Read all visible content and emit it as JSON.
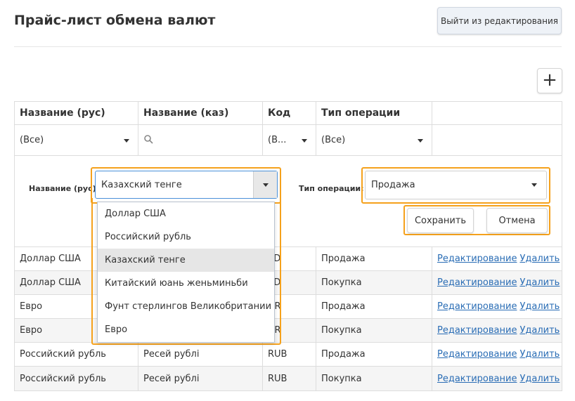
{
  "header": {
    "title": "Прайс-лист обмена валют",
    "exit_label": "Выйти из редактирования",
    "add_label": "+"
  },
  "grid": {
    "columns": [
      "Название (рус)",
      "Название (каз)",
      "Код",
      "Тип операции",
      ""
    ],
    "filters": {
      "name_ru": "(Все)",
      "name_kz": "",
      "code": "(В...",
      "operation": "(Все)"
    },
    "form": {
      "name_label": "Название (рус):",
      "name_value": "Казахский тенге",
      "op_label": "Тип операции:",
      "op_value": "Продажа",
      "save_label": "Сохранить",
      "cancel_label": "Отмена"
    },
    "rows": [
      {
        "name_ru": "Доллар США",
        "name_kz": "",
        "code": "SD",
        "op": "Продажа",
        "edit": "Редактирование",
        "del": "Удалить"
      },
      {
        "name_ru": "Доллар США",
        "name_kz": "",
        "code": "SD",
        "op": "Покупка",
        "edit": "Редактирование",
        "del": "Удалить"
      },
      {
        "name_ru": "Евро",
        "name_kz": "",
        "code": "UR",
        "op": "Продажа",
        "edit": "Редактирование",
        "del": "Удалить"
      },
      {
        "name_ru": "Евро",
        "name_kz": "",
        "code": "UR",
        "op": "Покупка",
        "edit": "Редактирование",
        "del": "Удалить"
      },
      {
        "name_ru": "Российский рубль",
        "name_kz": "Ресей рублі",
        "code": "RUB",
        "op": "Продажа",
        "edit": "Редактирование",
        "del": "Удалить"
      },
      {
        "name_ru": "Российский рубль",
        "name_kz": "Ресей рублі",
        "code": "RUB",
        "op": "Покупка",
        "edit": "Редактирование",
        "del": "Удалить"
      }
    ]
  },
  "dropdown": {
    "options": [
      "Доллар США",
      "Российский рубль",
      "Казахский тенге",
      "Китайский юань женьминьби",
      "Фунт стерлингов Великобритании",
      "Евро"
    ],
    "selected": "Казахский тенге"
  },
  "colors": {
    "highlight": "#f5a11c",
    "link": "#2a6db5"
  },
  "icons": [
    "plus-icon",
    "search-icon",
    "chevron-down-icon"
  ]
}
